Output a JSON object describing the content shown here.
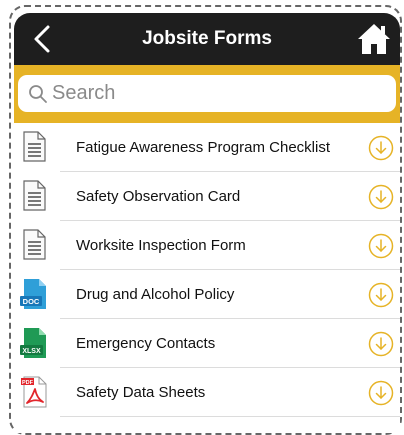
{
  "header": {
    "title": "Jobsite Forms"
  },
  "search": {
    "placeholder": "Search"
  },
  "forms": [
    {
      "label": "Fatigue Awareness Program Checklist",
      "type": "form"
    },
    {
      "label": "Safety Observation Card",
      "type": "form"
    },
    {
      "label": "Worksite Inspection Form",
      "type": "form"
    },
    {
      "label": "Drug and Alcohol Policy",
      "type": "doc",
      "badge": "DOC"
    },
    {
      "label": "Emergency Contacts",
      "type": "xlsx",
      "badge": "XLSX"
    },
    {
      "label": "Safety Data Sheets",
      "type": "pdf",
      "badge": "PDF"
    }
  ],
  "icons": {
    "back": "chevron-left-icon",
    "home": "home-icon",
    "search": "search-icon",
    "download": "download-circle-icon"
  },
  "colors": {
    "header_bg": "#1e1e1e",
    "accent": "#e6b326",
    "download": "#e6b326",
    "doc": "#2f9fd8",
    "xlsx": "#1f9a55",
    "pdf": "#e2262c"
  }
}
